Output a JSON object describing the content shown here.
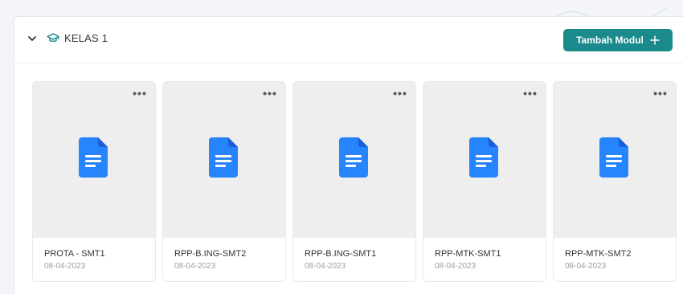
{
  "page": {
    "partial_title": "…"
  },
  "section": {
    "title": "KELAS 1",
    "add_button_label": "Tambah Modul",
    "colors": {
      "accent": "#1a8a8c",
      "doc_icon": "#2684fc"
    }
  },
  "modules": [
    {
      "name": "PROTA - SMT1",
      "date": "08-04-2023",
      "icon": "google-docs-icon"
    },
    {
      "name": "RPP-B.ING-SMT2",
      "date": "08-04-2023",
      "icon": "google-docs-icon"
    },
    {
      "name": "RPP-B.ING-SMT1",
      "date": "08-04-2023",
      "icon": "google-docs-icon"
    },
    {
      "name": "RPP-MTK-SMT1",
      "date": "08-04-2023",
      "icon": "google-docs-icon"
    },
    {
      "name": "RPP-MTK-SMT2",
      "date": "08-04-2023",
      "icon": "google-docs-icon"
    }
  ],
  "icons": {
    "collapse": "chevron-down-icon",
    "class": "graduation-cap-icon",
    "add": "plus-icon",
    "more": "more-options-icon"
  }
}
